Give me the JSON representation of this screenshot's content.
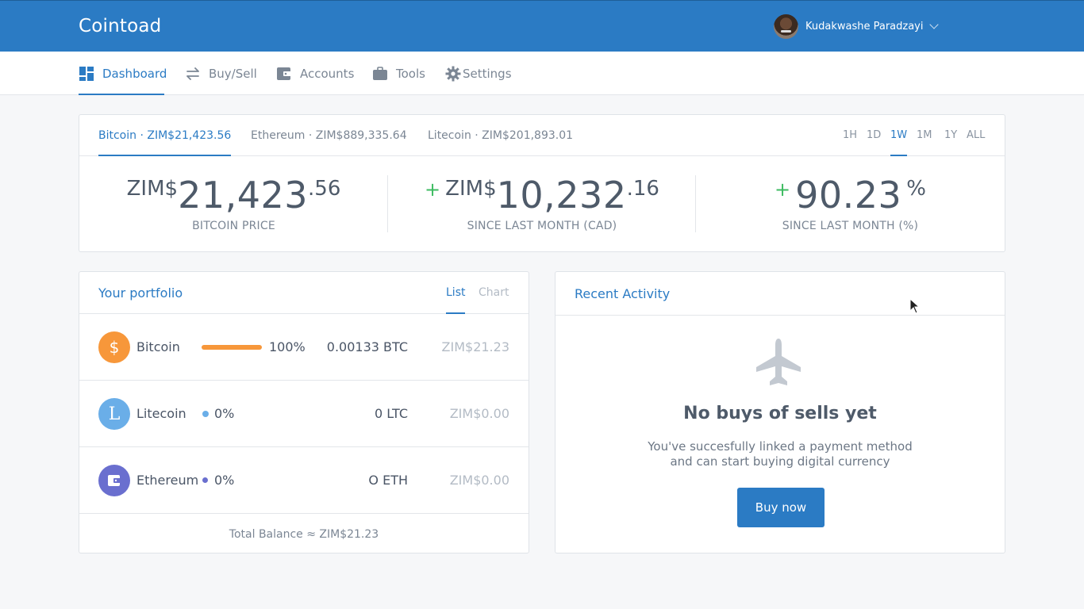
{
  "app": {
    "brand": "Cointoad"
  },
  "user": {
    "name": "Kudakwashe Paradzayi"
  },
  "nav": {
    "items": [
      {
        "label": "Dashboard",
        "icon": "dashboard-icon",
        "active": true
      },
      {
        "label": "Buy/Sell",
        "icon": "arrows-swap-icon"
      },
      {
        "label": "Accounts",
        "icon": "wallet-icon"
      },
      {
        "label": "Tools",
        "icon": "briefcase-icon"
      },
      {
        "label": "Settings",
        "icon": "gear-icon"
      }
    ]
  },
  "price": {
    "tabs": [
      {
        "label": "Bitcoin · ZIM$21,423.56",
        "active": true
      },
      {
        "label": "Ethereum · ZIM$889,335.64"
      },
      {
        "label": "Litecoin · ZIM$201,893.01"
      }
    ],
    "ranges": [
      "1H",
      "1D",
      "1W",
      "1M",
      "1Y",
      "ALL"
    ],
    "active_range": "1W",
    "stats": [
      {
        "plus": "",
        "currency": "ZIM$",
        "number": "21,423",
        "decimal": ".56",
        "label": "BITCOIN PRICE"
      },
      {
        "plus": "+",
        "currency": "ZIM$",
        "number": "10,232",
        "decimal": ".16",
        "label": "SINCE LAST MONTH (CAD)"
      },
      {
        "plus": "+",
        "currency": "",
        "number": "90.23",
        "decimal": "%",
        "label": "SINCE LAST MONTH (%)"
      }
    ]
  },
  "portfolio": {
    "title": "Your portfolio",
    "views": [
      "List",
      "Chart"
    ],
    "active_view": "List",
    "rows": [
      {
        "name": "Bitcoin",
        "icon": "dollar-icon",
        "icon_glyph": "$",
        "color": "#f7973a",
        "percent": "100%",
        "share": 1.0,
        "amount": "0.00133 BTC",
        "value": "ZIM$21.23"
      },
      {
        "name": "Litecoin",
        "icon": "litecoin-icon",
        "icon_glyph": "L",
        "color": "#6aaee8",
        "percent": "0%",
        "share": 0,
        "amount": "0 LTC",
        "value": "ZIM$0.00"
      },
      {
        "name": "Ethereum",
        "icon": "wallet-icon",
        "icon_glyph": "",
        "color": "#6a6fcf",
        "percent": "0%",
        "share": 0,
        "amount": "O ETH",
        "value": "ZIM$0.00"
      }
    ],
    "total": "Total Balance ≈ ZIM$21.23"
  },
  "activity": {
    "title": "Recent Activity",
    "empty_icon": "airplane-icon",
    "empty_title": "No buys of sells yet",
    "empty_line1": "You've succesfully linked a payment method",
    "empty_line2": "and can start buying digital currency",
    "button": "Buy now"
  },
  "colors": {
    "primary": "#2b7bc4",
    "positive": "#3dbb61",
    "bitcoin": "#f7973a"
  }
}
